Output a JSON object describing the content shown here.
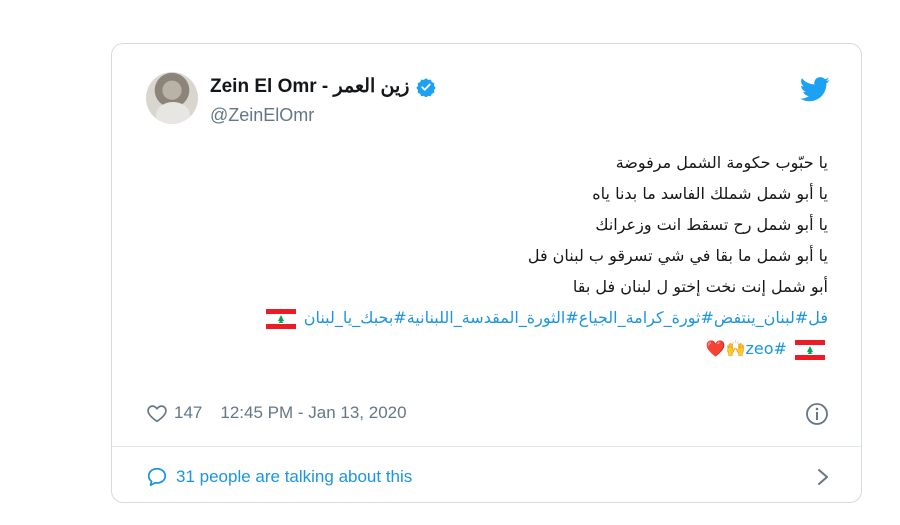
{
  "tweet": {
    "display_name": "Zein El Omr - زين العمر",
    "handle": "@ZeinElOmr",
    "lines": [
      "يا حبّوب حكومة الشمل مرفوضة",
      "يا أبو شمل شملك الفاسد ما بدنا ياه",
      "يا أبو شمل رح تسقط انت وزعرانك",
      "يا أبو شمل ما بقا في شي تسرقو ب لبنان فل",
      "أبو شمل إنت نخت إختو ل لبنان فل بقا"
    ],
    "hashtags_line1": "فل#لبنان_ينتفض#ثورة_كرامة_الجياع#الثورة_المقدسة_اللبنانية#بحبك_يا_لبنان",
    "hashtags_line2": "#zeo🙌❤️",
    "likes": "147",
    "timestamp": "12:45 PM - Jan 13, 2020",
    "talking": "31 people are talking about this"
  },
  "colors": {
    "link": "#1b95e0",
    "text": "#14171a",
    "muted": "#657786",
    "heart": "#e0245e"
  },
  "icons": [
    "verified-icon",
    "twitter-icon",
    "heart-icon",
    "info-icon",
    "talk-icon",
    "chevron-right-icon",
    "lebanon-flag-icon"
  ]
}
